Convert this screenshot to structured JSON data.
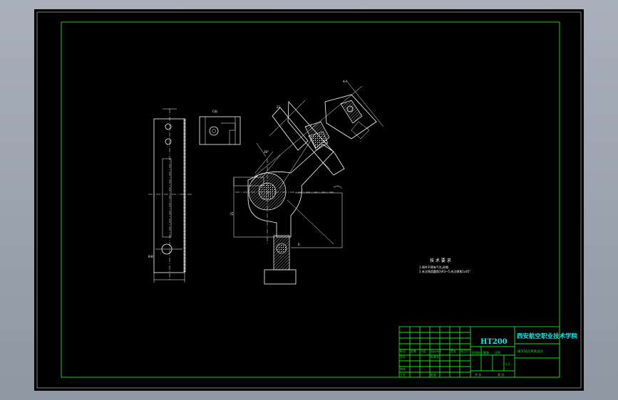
{
  "drawing": {
    "material": "HT200",
    "school": "西安航空职业技术学院",
    "part_name": "拨叉钻孔夹具设计",
    "scale": "1:1",
    "tech_req_title": "技 术 要 求",
    "tech_req_lines": [
      "1.铸件不得有气孔,砂眼",
      "2.未注铸造圆角为R3~5,未注倒角1x45°"
    ],
    "title_block": {
      "row1": [
        "标记",
        "处数",
        "分区",
        "更改文件号",
        "签名",
        "年月日"
      ],
      "row2": [
        "设计",
        "",
        "",
        "标准化",
        "",
        ""
      ],
      "row3": [
        "审核",
        "",
        "",
        "",
        "",
        ""
      ],
      "row4": [
        "工艺",
        "",
        "",
        "批准",
        "",
        ""
      ],
      "stage_labels": [
        "阶段标记",
        "重量",
        "比例"
      ],
      "bottom_labels": [
        "共 张",
        "第 张"
      ]
    },
    "view_labels": {
      "section_a": "A-A",
      "section_b": "B-B",
      "view_c": "C向"
    }
  }
}
